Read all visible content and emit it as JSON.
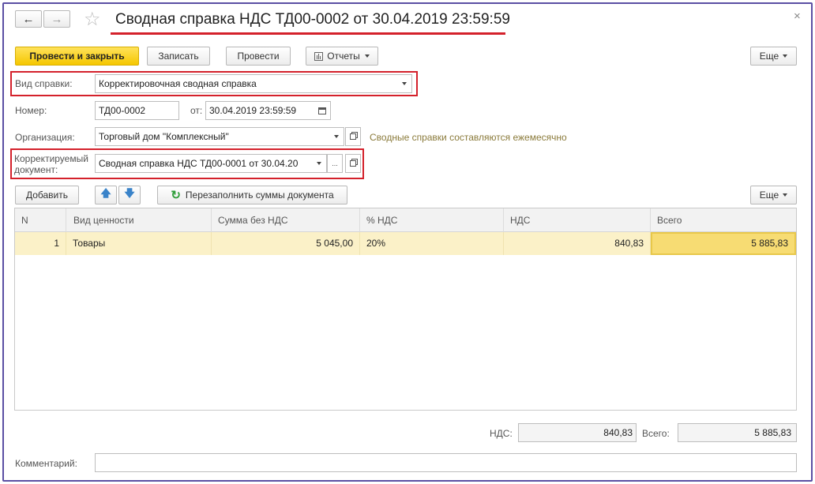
{
  "window": {
    "title": "Сводная справка НДС ТД00-0002 от 30.04.2019 23:59:59",
    "close_glyph": "×"
  },
  "nav": {
    "back_glyph": "←",
    "forward_glyph": "→",
    "star_glyph": "☆"
  },
  "toolbar": {
    "post_close_label": "Провести и закрыть",
    "save_label": "Записать",
    "post_label": "Провести",
    "reports_label": "Отчеты",
    "more_label": "Еще"
  },
  "form": {
    "kind_label": "Вид справки:",
    "kind_value": "Корректировочная сводная справка",
    "number_label": "Номер:",
    "number_value": "ТД00-0002",
    "date_label": "от:",
    "date_value": "30.04.2019 23:59:59",
    "org_label": "Организация:",
    "org_value": "Торговый дом \"Комплексный\"",
    "org_hint": "Сводные справки составляются ежемесячно",
    "corrected_label_line1": "Корректируемый",
    "corrected_label_line2": "документ:",
    "corrected_value": "Сводная справка НДС ТД00-0001 от 30.04.20",
    "ellipsis": "..."
  },
  "table_toolbar": {
    "add_label": "Добавить",
    "refill_label": "Перезаполнить суммы документа",
    "more_label": "Еще"
  },
  "table": {
    "columns": [
      "N",
      "Вид ценности",
      "Сумма без НДС",
      "% НДС",
      "НДС",
      "Всего"
    ],
    "rows": [
      {
        "n": "1",
        "kind": "Товары",
        "sum": "5 045,00",
        "rate": "20%",
        "vat": "840,83",
        "total": "5 885,83"
      }
    ]
  },
  "totals": {
    "vat_label": "НДС:",
    "vat_value": "840,83",
    "total_label": "Всего:",
    "total_value": "5 885,83"
  },
  "comment": {
    "label": "Комментарий:",
    "value": ""
  },
  "colors": {
    "accent_yellow": "#f5c700",
    "highlight_red": "#d4212b",
    "hint_text": "#8a7a3a",
    "frame": "#5b4fa3"
  }
}
